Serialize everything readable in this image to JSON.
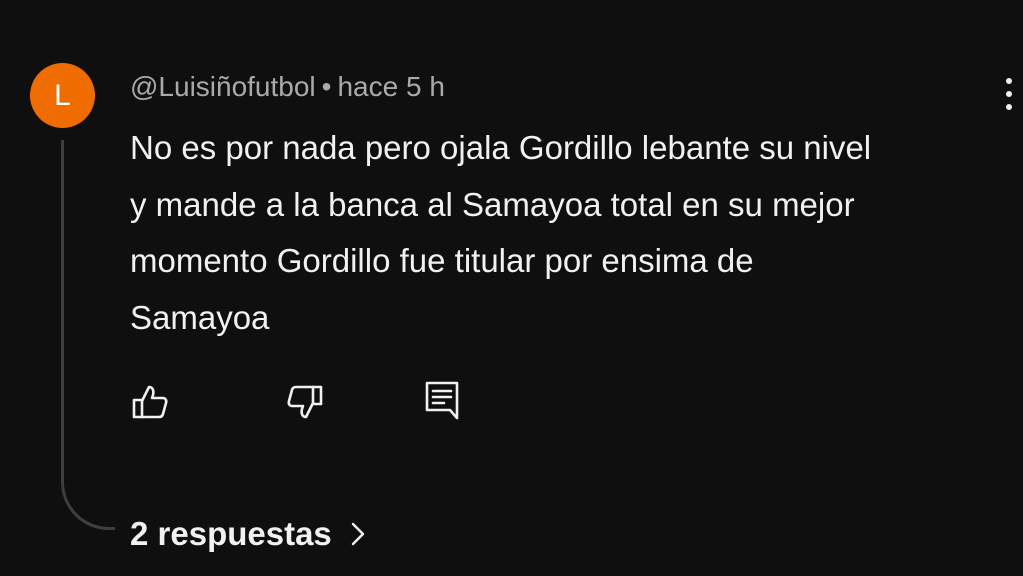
{
  "comment": {
    "avatar_letter": "L",
    "avatar_color": "#ef6c00",
    "author": "@Luisiñofutbol",
    "separator": "•",
    "time": "hace 5 h",
    "lines": [
      "No es por nada pero ojala Gordillo lebante su nivel",
      "y mande a la banca al Samayoa total en su mejor",
      "momento Gordillo fue titular por ensima de",
      "Samayoa"
    ],
    "replies_label": "2 respuestas"
  },
  "icons": {
    "menu": "more-vert-icon",
    "like": "thumb-up-icon",
    "dislike": "thumb-down-icon",
    "reply": "comment-reply-icon",
    "expand": "chevron-right-icon"
  }
}
